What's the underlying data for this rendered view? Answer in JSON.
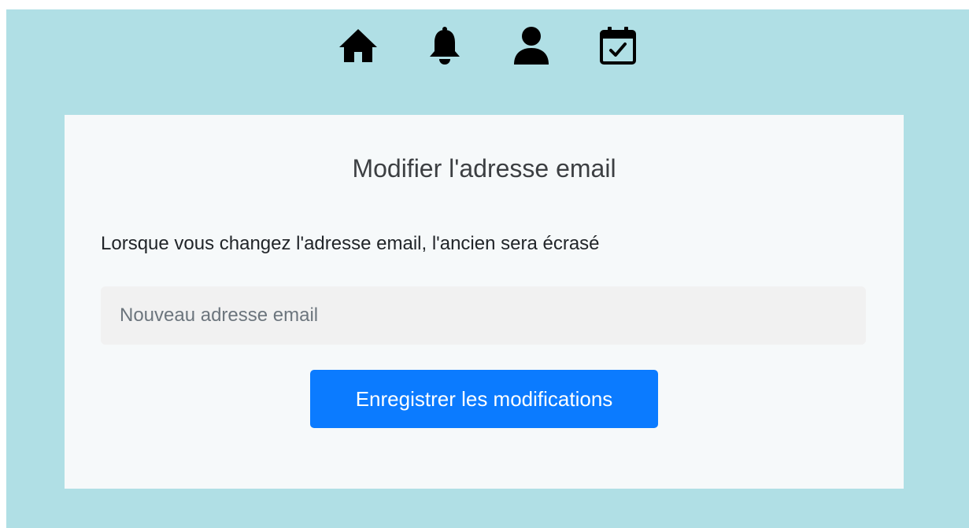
{
  "nav": {
    "items": [
      {
        "icon": "home-icon"
      },
      {
        "icon": "bell-icon"
      },
      {
        "icon": "user-icon"
      },
      {
        "icon": "calendar-check-icon"
      }
    ]
  },
  "card": {
    "title": "Modifier l'adresse email",
    "description": "Lorsque vous changez l'adresse email, l'ancien sera écrasé",
    "email_input": {
      "value": "",
      "placeholder": "Nouveau adresse email"
    },
    "save_label": "Enregistrer les modifications"
  },
  "colors": {
    "page_background": "#b0dfe5",
    "card_background": "#f6f9fa",
    "primary_button": "#0b7bff",
    "input_background": "#f1f1f1"
  }
}
